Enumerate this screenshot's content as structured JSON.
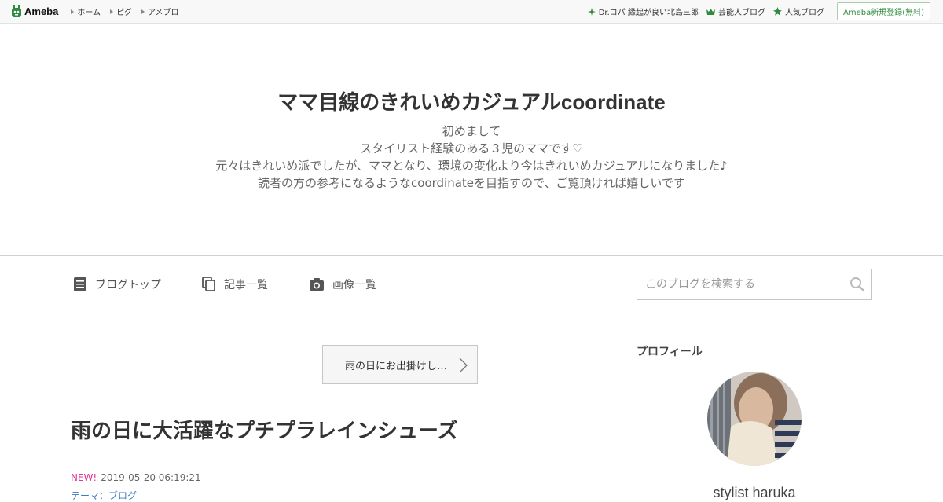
{
  "topbar": {
    "logo_text": "Ameba",
    "nav": [
      "ホーム",
      "ピグ",
      "アメブロ"
    ],
    "links": [
      {
        "label": "Dr.コパ 縁起が良い北島三郎",
        "icon": "sparkle-icon"
      },
      {
        "label": "芸能人ブログ",
        "icon": "crown-icon"
      },
      {
        "label": "人気ブログ",
        "icon": "star-icon"
      }
    ],
    "register_label": "Ameba新規登録(無料)"
  },
  "header": {
    "title": "ママ目線のきれいめカジュアルcoordinate",
    "description": [
      "初めまして",
      "スタイリスト経験のある３児のママです♡",
      "元々はきれいめ派でしたが、ママとなり、環境の変化より今はきれいめカジュアルになりました♪",
      "読者の方の参考になるようなcoordinateを目指すので、ご覧頂ければ嬉しいです"
    ]
  },
  "navbar": {
    "items": [
      {
        "label": "ブログトップ",
        "icon": "document-icon"
      },
      {
        "label": "記事一覧",
        "icon": "copy-icon"
      },
      {
        "label": "画像一覧",
        "icon": "camera-icon"
      }
    ],
    "search_placeholder": "このブログを検索する"
  },
  "main": {
    "prev_link_label": "雨の日にお出掛けし…",
    "entry_title": "雨の日に大活躍なプチプラレインシューズ",
    "new_badge": "NEW!",
    "entry_date": "2019-05-20 06:19:21",
    "entry_theme": "テーマ：ブログ"
  },
  "sidebar": {
    "heading": "プロフィール",
    "profile_name": "stylist haruka"
  },
  "colors": {
    "accent_green": "#2d8a3e",
    "new_badge": "#e0379a",
    "link_blue": "#3c7cc0"
  }
}
